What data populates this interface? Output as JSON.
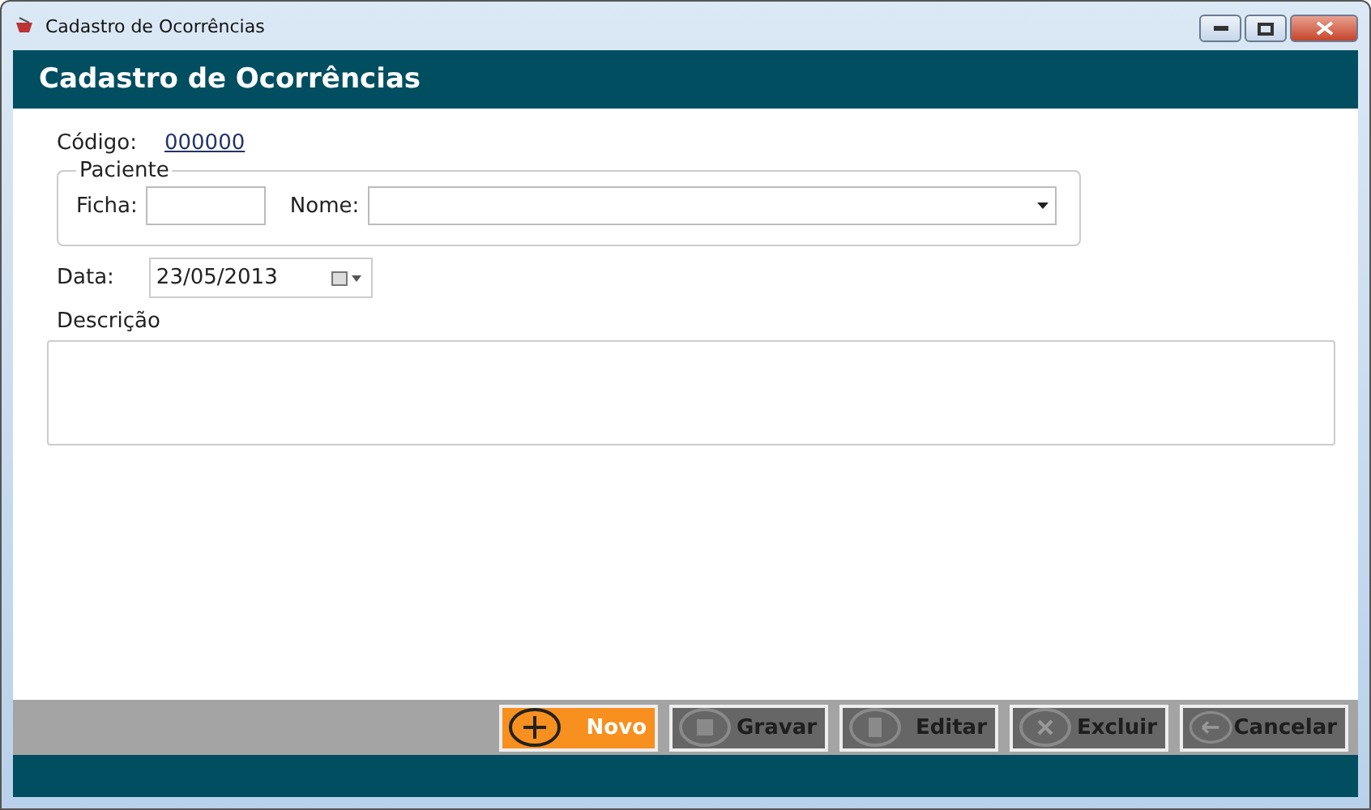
{
  "window": {
    "title": "Cadastro de Ocorrências"
  },
  "header": {
    "title": "Cadastro de Ocorrências"
  },
  "form": {
    "codigo": {
      "label": "Código:",
      "value": "000000"
    },
    "paciente": {
      "legend": "Paciente",
      "ficha_label": "Ficha:",
      "nome_label": "Nome:"
    },
    "data": {
      "label": "Data:",
      "value": "23/05/2013"
    },
    "descricao": {
      "label": "Descrição"
    }
  },
  "buttons": [
    {
      "label": "Novo",
      "kind": "new",
      "disabled": false
    },
    {
      "label": "Gravar",
      "kind": "save",
      "disabled": true
    },
    {
      "label": "Editar",
      "kind": "edit",
      "disabled": true
    },
    {
      "label": "Excluir",
      "kind": "delete",
      "disabled": true
    },
    {
      "label": "Cancelar",
      "kind": "cancel",
      "disabled": true
    }
  ]
}
